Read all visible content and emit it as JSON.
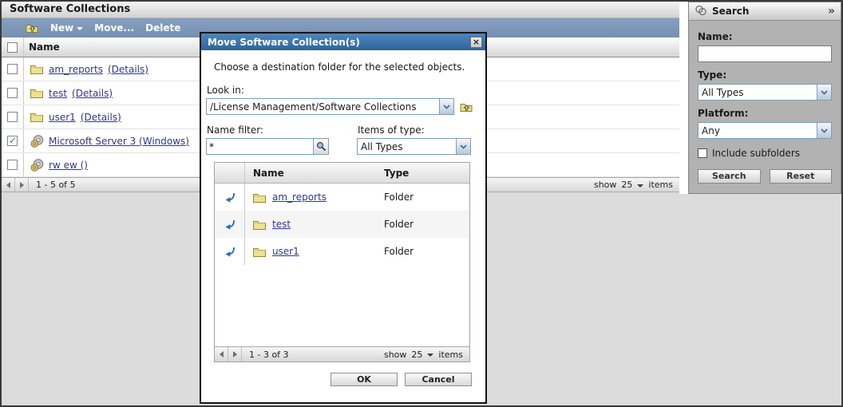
{
  "window": {
    "title": "Software Collections"
  },
  "main": {
    "toolbar": {
      "new_label": "New",
      "move_label": "Move...",
      "delete_label": "Delete"
    },
    "list": {
      "name_header": "Name",
      "rows": [
        {
          "name": "am_reports",
          "details": "(Details)",
          "icon": "folder",
          "checked": false
        },
        {
          "name": "test",
          "details": "(Details)",
          "icon": "folder",
          "checked": false
        },
        {
          "name": "user1",
          "details": "(Details)",
          "icon": "folder",
          "checked": false
        },
        {
          "name": "Microsoft Server 3 (Windows)",
          "details": "",
          "icon": "software-collection",
          "checked": true
        },
        {
          "name": "rw ew ()",
          "details": "",
          "icon": "software-collection",
          "checked": false
        }
      ],
      "pagination": {
        "range": "1 - 5 of 5",
        "show_label": "show",
        "page_size": "25",
        "items_label": "items"
      }
    }
  },
  "dialog": {
    "title": "Move Software Collection(s)",
    "close_glyph": "×",
    "instruction": "Choose a destination folder for the selected objects.",
    "look_in": {
      "label": "Look in:",
      "value": "/License Management/Software Collections"
    },
    "name_filter": {
      "label": "Name filter:",
      "value": "*"
    },
    "items_of_type": {
      "label": "Items of type:",
      "value": "All Types"
    },
    "table": {
      "name_header": "Name",
      "type_header": "Type",
      "rows": [
        {
          "name": "am_reports",
          "type": "Folder"
        },
        {
          "name": "test",
          "type": "Folder"
        },
        {
          "name": "user1",
          "type": "Folder"
        }
      ],
      "pagination": {
        "range": "1 - 3 of 3",
        "show_label": "show",
        "page_size": "25",
        "items_label": "items"
      }
    },
    "ok_label": "OK",
    "cancel_label": "Cancel"
  },
  "search_panel": {
    "title": "Search",
    "collapse_glyph": "»",
    "name": {
      "label": "Name:",
      "value": ""
    },
    "type": {
      "label": "Type:",
      "value": "All Types"
    },
    "platform": {
      "label": "Platform:",
      "value": "Any"
    },
    "include_subfolders_label": "Include subfolders",
    "search_label": "Search",
    "reset_label": "Reset"
  },
  "colors": {
    "toolbar_blue": "#7b95b7",
    "dialog_title_blue": "#3a74ad",
    "link_navy": "#333399",
    "check_green": "#2e9e2e",
    "folder_yellow": "#ede292",
    "panel_gray": "#b2b2b2",
    "page_gray": "#dcdcdc"
  }
}
